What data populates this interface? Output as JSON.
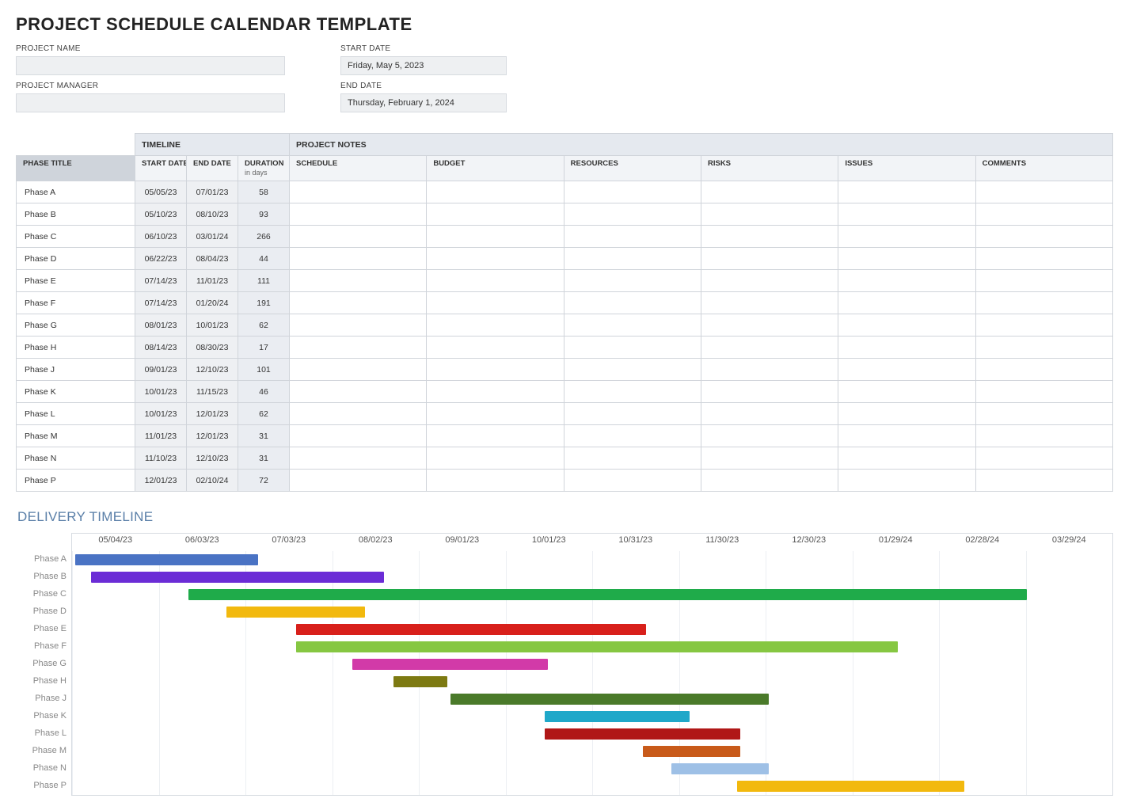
{
  "title": "PROJECT SCHEDULE CALENDAR TEMPLATE",
  "meta": {
    "project_name_label": "PROJECT NAME",
    "project_name_value": "",
    "project_manager_label": "PROJECT MANAGER",
    "project_manager_value": "",
    "start_date_label": "START DATE",
    "start_date_value": "Friday, May 5, 2023",
    "end_date_label": "END DATE",
    "end_date_value": "Thursday, February 1, 2024"
  },
  "table": {
    "super": {
      "timeline": "TIMELINE",
      "notes": "PROJECT NOTES"
    },
    "headers": {
      "phase": "PHASE TITLE",
      "start": "START DATE",
      "end": "END DATE",
      "duration": "DURATION",
      "duration_sub": "in days",
      "schedule": "SCHEDULE",
      "budget": "BUDGET",
      "resources": "RESOURCES",
      "risks": "RISKS",
      "issues": "ISSUES",
      "comments": "COMMENTS"
    },
    "rows": [
      {
        "phase": "Phase A",
        "start": "05/05/23",
        "end": "07/01/23",
        "dur": "58"
      },
      {
        "phase": "Phase B",
        "start": "05/10/23",
        "end": "08/10/23",
        "dur": "93"
      },
      {
        "phase": "Phase C",
        "start": "06/10/23",
        "end": "03/01/24",
        "dur": "266"
      },
      {
        "phase": "Phase D",
        "start": "06/22/23",
        "end": "08/04/23",
        "dur": "44"
      },
      {
        "phase": "Phase E",
        "start": "07/14/23",
        "end": "11/01/23",
        "dur": "111"
      },
      {
        "phase": "Phase F",
        "start": "07/14/23",
        "end": "01/20/24",
        "dur": "191"
      },
      {
        "phase": "Phase G",
        "start": "08/01/23",
        "end": "10/01/23",
        "dur": "62"
      },
      {
        "phase": "Phase H",
        "start": "08/14/23",
        "end": "08/30/23",
        "dur": "17"
      },
      {
        "phase": "Phase J",
        "start": "09/01/23",
        "end": "12/10/23",
        "dur": "101"
      },
      {
        "phase": "Phase K",
        "start": "10/01/23",
        "end": "11/15/23",
        "dur": "46"
      },
      {
        "phase": "Phase L",
        "start": "10/01/23",
        "end": "12/01/23",
        "dur": "62"
      },
      {
        "phase": "Phase M",
        "start": "11/01/23",
        "end": "12/01/23",
        "dur": "31"
      },
      {
        "phase": "Phase N",
        "start": "11/10/23",
        "end": "12/10/23",
        "dur": "31"
      },
      {
        "phase": "Phase P",
        "start": "12/01/23",
        "end": "02/10/24",
        "dur": "72"
      }
    ]
  },
  "delivery_title": "DELIVERY TIMELINE",
  "chart_data": {
    "type": "bar",
    "orientation": "horizontal-gantt",
    "x_ticks": [
      "05/04/23",
      "06/03/23",
      "07/03/23",
      "08/02/23",
      "09/01/23",
      "10/01/23",
      "10/31/23",
      "11/30/23",
      "12/30/23",
      "01/29/24",
      "02/28/24",
      "03/29/24"
    ],
    "x_domain_days": 330,
    "x_origin": "05/04/23",
    "series": [
      {
        "name": "Phase A",
        "start_offset_days": 1,
        "duration_days": 58,
        "color": "#4a73c4"
      },
      {
        "name": "Phase B",
        "start_offset_days": 6,
        "duration_days": 93,
        "color": "#6b2cd6"
      },
      {
        "name": "Phase C",
        "start_offset_days": 37,
        "duration_days": 266,
        "color": "#1fab4a"
      },
      {
        "name": "Phase D",
        "start_offset_days": 49,
        "duration_days": 44,
        "color": "#f2b90e"
      },
      {
        "name": "Phase E",
        "start_offset_days": 71,
        "duration_days": 111,
        "color": "#d8201b"
      },
      {
        "name": "Phase F",
        "start_offset_days": 71,
        "duration_days": 191,
        "color": "#86c742"
      },
      {
        "name": "Phase G",
        "start_offset_days": 89,
        "duration_days": 62,
        "color": "#d23aa8"
      },
      {
        "name": "Phase H",
        "start_offset_days": 102,
        "duration_days": 17,
        "color": "#7d7a12"
      },
      {
        "name": "Phase J",
        "start_offset_days": 120,
        "duration_days": 101,
        "color": "#4a7a2a"
      },
      {
        "name": "Phase K",
        "start_offset_days": 150,
        "duration_days": 46,
        "color": "#1fa8c9"
      },
      {
        "name": "Phase L",
        "start_offset_days": 150,
        "duration_days": 62,
        "color": "#b01717"
      },
      {
        "name": "Phase M",
        "start_offset_days": 181,
        "duration_days": 31,
        "color": "#c85a1a"
      },
      {
        "name": "Phase N",
        "start_offset_days": 190,
        "duration_days": 31,
        "color": "#9ec0e6"
      },
      {
        "name": "Phase P",
        "start_offset_days": 211,
        "duration_days": 72,
        "color": "#f2b90e"
      }
    ]
  }
}
